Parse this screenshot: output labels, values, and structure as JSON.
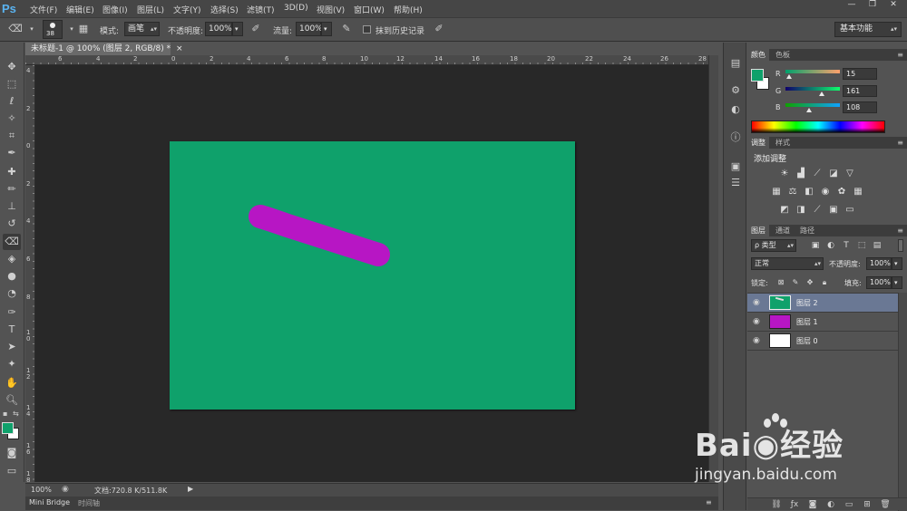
{
  "app": {
    "logo": "Ps"
  },
  "menu": [
    "文件(F)",
    "编辑(E)",
    "图像(I)",
    "图层(L)",
    "文字(Y)",
    "选择(S)",
    "滤镜(T)",
    "3D(D)",
    "视图(V)",
    "窗口(W)",
    "帮助(H)"
  ],
  "window_buttons": {
    "minimize": "—",
    "restore": "❐",
    "close": "✕"
  },
  "options": {
    "brush_size": "38",
    "mode_label": "模式:",
    "mode_value": "画笔",
    "opacity_label": "不透明度:",
    "opacity_value": "100%",
    "flow_label": "流量:",
    "flow_value": "100%",
    "history_label": "抹到历史记录",
    "workspace": "基本功能"
  },
  "document": {
    "tab_title": "未标题-1 @ 100% (图层 2, RGB/8) *",
    "close": "×",
    "ruler_top": [
      "6",
      "4",
      "2",
      "0",
      "2",
      "4",
      "6",
      "8",
      "10",
      "12",
      "14",
      "16",
      "18",
      "20",
      "22",
      "24",
      "26",
      "28"
    ],
    "ruler_left": [
      "4",
      "2",
      "0",
      "2",
      "4",
      "6",
      "8",
      "1\n0",
      "1\n2",
      "1\n4",
      "1\n6",
      "1\n8"
    ],
    "canvas_color": "#0fa16b",
    "stroke_color": "#b716c4"
  },
  "status": {
    "zoom": "100%",
    "doc_info": "文档:720.8 K/511.8K"
  },
  "bottom_tabs": [
    "Mini Bridge",
    "时间轴"
  ],
  "color_panel": {
    "tabs": [
      "颜色",
      "色板"
    ],
    "foreground": "#0fa16b",
    "background": "#ffffff",
    "R": {
      "label": "R",
      "value": "15"
    },
    "G": {
      "label": "G",
      "value": "161"
    },
    "B": {
      "label": "B",
      "value": "108"
    }
  },
  "adjust_panel": {
    "tabs": [
      "调整",
      "样式"
    ],
    "title": "添加调整"
  },
  "layers_panel": {
    "tabs": [
      "图层",
      "通道",
      "路径"
    ],
    "filter_label": "ρ 类型",
    "blend_mode": "正常",
    "opacity_label": "不透明度:",
    "opacity_value": "100%",
    "lock_label": "锁定:",
    "fill_label": "填充:",
    "fill_value": "100%",
    "layers": [
      {
        "name": "图层 2",
        "thumb": "#0fa16b",
        "selected": true
      },
      {
        "name": "图层 1",
        "thumb": "#b716c4",
        "selected": false
      },
      {
        "name": "图层 0",
        "thumb": "#ffffff",
        "selected": false
      }
    ]
  },
  "watermark": {
    "brand": "Bai◉经验",
    "url": "jingyan.baidu.com"
  }
}
